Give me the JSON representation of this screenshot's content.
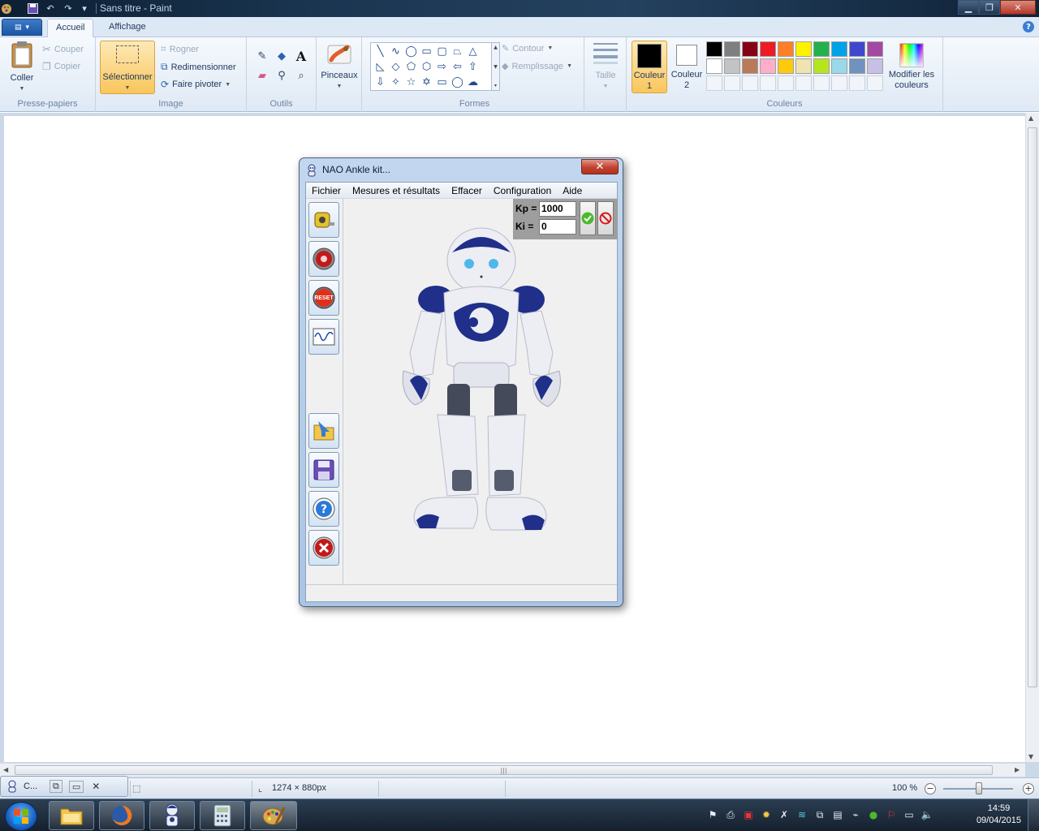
{
  "window": {
    "title": "Sans titre - Paint"
  },
  "tabs": {
    "home": "Accueil",
    "view": "Affichage"
  },
  "clipboard": {
    "paste": "Coller",
    "cut": "Couper",
    "copy": "Copier",
    "label": "Presse-papiers"
  },
  "image": {
    "select": "Sélectionner",
    "crop": "Rogner",
    "resize": "Redimensionner",
    "rotate": "Faire pivoter",
    "label": "Image"
  },
  "tools": {
    "label": "Outils"
  },
  "brushes": {
    "label": "Pinceaux"
  },
  "shapes": {
    "label": "Formes",
    "outline": "Contour",
    "fill": "Remplissage",
    "items": [
      "line",
      "curve",
      "oval",
      "rectangle",
      "rounded-rectangle",
      "polygon",
      "triangle",
      "right-triangle",
      "diamond",
      "pentagon",
      "hexagon",
      "right-arrow",
      "left-arrow",
      "up-arrow",
      "down-arrow",
      "four-point-star",
      "five-point-star",
      "six-point-star",
      "rounded-callout",
      "oval-callout",
      "cloud-callout"
    ]
  },
  "size": {
    "label": "Taille"
  },
  "colors": {
    "label": "Couleurs",
    "color1_line1": "Couleur",
    "color1_line2": "1",
    "color2_line1": "Couleur",
    "color2_line2": "2",
    "edit_line1": "Modifier les",
    "edit_line2": "couleurs",
    "color1": "#000000",
    "color2": "#ffffff",
    "palette_row1": [
      "#000000",
      "#7f7f7f",
      "#880015",
      "#ed1c24",
      "#ff7f27",
      "#fff200",
      "#22b14c",
      "#00a2e8",
      "#3f48cc",
      "#a349a4"
    ],
    "palette_row2": [
      "#ffffff",
      "#c3c3c3",
      "#b97a57",
      "#ffaec9",
      "#ffc90e",
      "#efe4b0",
      "#b5e61d",
      "#99d9ea",
      "#7092be",
      "#c8bfe7"
    ]
  },
  "nao": {
    "title": "NAO Ankle kit...",
    "menus": [
      "Fichier",
      "Mesures et résultats",
      "Effacer",
      "Configuration",
      "Aide"
    ],
    "kp_label": "Kp =",
    "kp_value": "1000",
    "ki_label": "Ki =",
    "ki_value": "0",
    "toolbar_icons": [
      "measure-tape-icon",
      "record-icon",
      "reset-icon",
      "graph-icon",
      "open-folder-icon",
      "save-disk-icon",
      "help-icon",
      "close-icon"
    ],
    "reset_text": "RESET"
  },
  "statusbar": {
    "dimensions": "1274 × 880px",
    "zoom": "100 %",
    "floating_title": "C..."
  },
  "taskbar": {
    "time": "14:59",
    "date": "09/04/2015",
    "apps": [
      "explorer-icon",
      "firefox-icon",
      "nao-robot-icon",
      "calculator-icon",
      "paint-icon"
    ]
  }
}
